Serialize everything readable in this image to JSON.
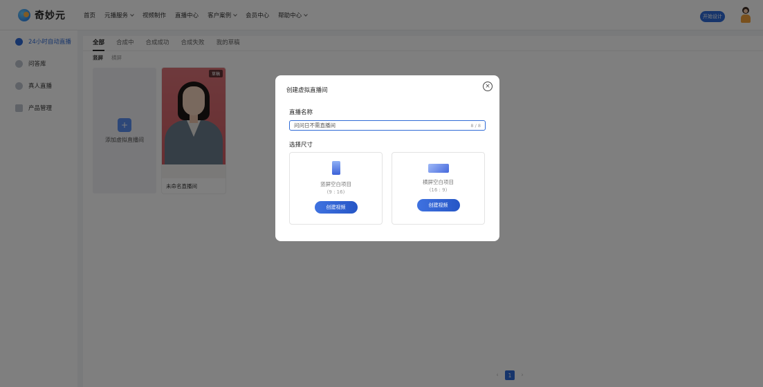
{
  "brand": {
    "name": "奇妙元"
  },
  "nav": {
    "items": [
      {
        "label": "首页",
        "dropdown": false
      },
      {
        "label": "元播服务",
        "dropdown": true
      },
      {
        "label": "视频制作",
        "dropdown": false
      },
      {
        "label": "直播中心",
        "dropdown": false
      },
      {
        "label": "客户案例",
        "dropdown": true
      },
      {
        "label": "会员中心",
        "dropdown": false
      },
      {
        "label": "帮助中心",
        "dropdown": true
      }
    ],
    "start_button": "开始设计"
  },
  "sidebar": {
    "items": [
      {
        "label": "24小时自动直播",
        "active": true
      },
      {
        "label": "问答库",
        "active": false
      },
      {
        "label": "真人直播",
        "active": false
      },
      {
        "label": "产品管理",
        "active": false
      }
    ]
  },
  "main": {
    "tabs": [
      {
        "label": "全部",
        "active": true
      },
      {
        "label": "合成中",
        "active": false
      },
      {
        "label": "合成成功",
        "active": false
      },
      {
        "label": "合成失败",
        "active": false
      },
      {
        "label": "我的草稿",
        "active": false
      }
    ],
    "subtabs": [
      {
        "label": "竖屏",
        "active": true
      },
      {
        "label": "横屏",
        "active": false
      }
    ],
    "add_card_label": "添加虚拟直播间",
    "room_card": {
      "badge": "草稿",
      "name": "未命名直播间"
    },
    "pagination": {
      "current": "1",
      "prev": "‹",
      "next": "›"
    }
  },
  "modal": {
    "title": "创建虚拟直播间",
    "close": "×",
    "name_label": "直播名称",
    "name_value": "问问日不需直播间",
    "name_count": "8 / 8",
    "size_label": "选择尺寸",
    "portrait": {
      "title": "竖屏空白项目",
      "ratio": "(9 : 16)",
      "button": "创建视频"
    },
    "landscape": {
      "title": "横屏空白项目",
      "ratio": "(16 : 9)",
      "button": "创建视频"
    }
  },
  "colors": {
    "accent": "#2f6bd6",
    "overlay": "rgba(0,0,0,0.5)"
  }
}
